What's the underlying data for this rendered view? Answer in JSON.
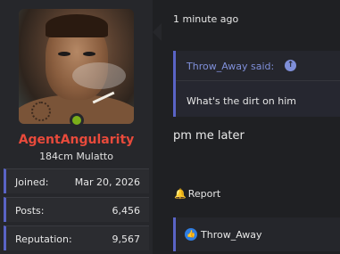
{
  "user": {
    "name": "AgentAngularity",
    "title": "184cm Mulatto",
    "stats": [
      {
        "label": "Joined:",
        "value": "Mar 20, 2026"
      },
      {
        "label": "Posts:",
        "value": "6,456"
      },
      {
        "label": "Reputation:",
        "value": "9,567"
      }
    ]
  },
  "post": {
    "timestamp": "1 minute ago",
    "quote": {
      "author": "Throw_Away said:",
      "text": "What's the dirt on him"
    },
    "body": "pm me later",
    "report_label": "Report",
    "likes": {
      "names": "Throw_Away"
    }
  },
  "colors": {
    "username": "#e84a3b",
    "accent": "#5a64c6",
    "online": "#7aae1a",
    "link": "#7f8fd9",
    "like": "#2f7de1"
  },
  "icons": {
    "online": "online-status-dot",
    "quote_jump": "arrow-up-circle-icon",
    "report": "bell-icon",
    "like": "thumbs-up-icon"
  }
}
